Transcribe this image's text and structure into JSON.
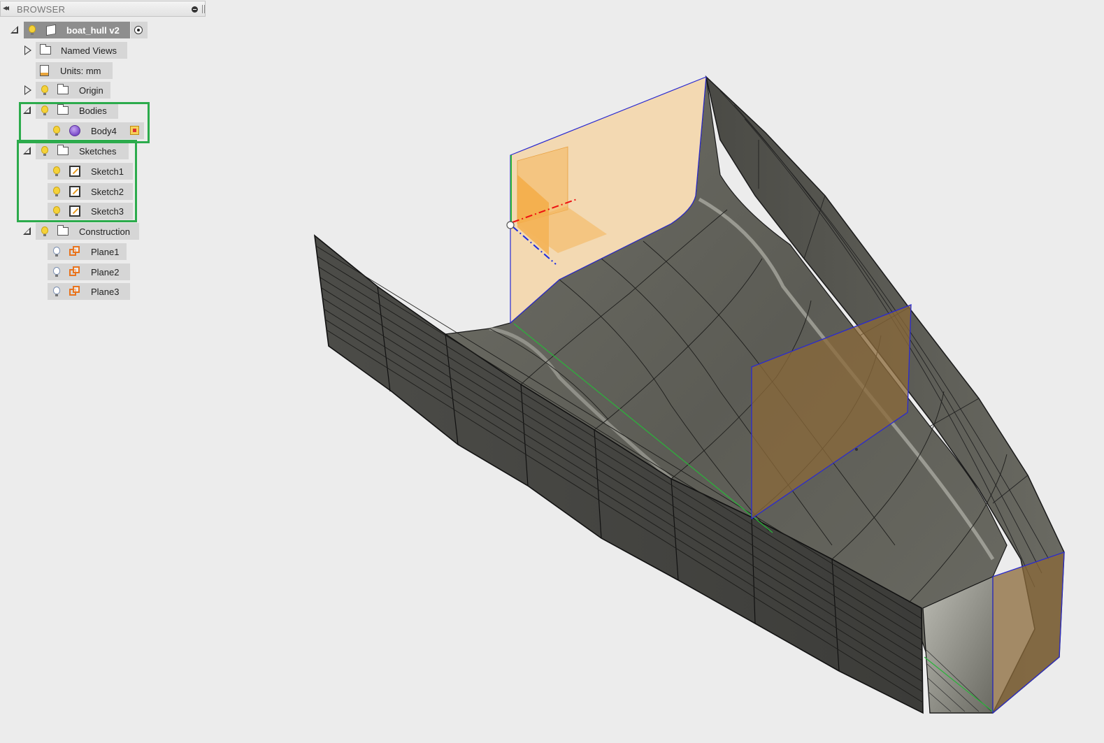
{
  "browser": {
    "header_title": "BROWSER",
    "root": {
      "label": "boat_hull v2"
    },
    "items": {
      "named_views": "Named Views",
      "units": "Units: mm",
      "origin": "Origin",
      "bodies": "Bodies",
      "body4": "Body4",
      "sketches": "Sketches",
      "sketch1": "Sketch1",
      "sketch2": "Sketch2",
      "sketch3": "Sketch3",
      "construction": "Construction",
      "plane1": "Plane1",
      "plane2": "Plane2",
      "plane3": "Plane3"
    }
  },
  "colors": {
    "highlight": "#2cab4c",
    "hull_surface": "#5f5f57",
    "sketch_plane": "#f3d7ad",
    "selected_plane": "#8b6a3a",
    "background": "#ececec"
  }
}
